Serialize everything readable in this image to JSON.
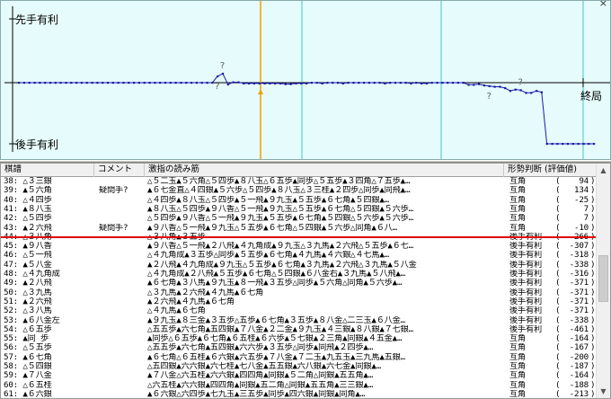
{
  "graph": {
    "top_label": "先手有利",
    "bottom_label": "後手有利",
    "end_label": "終局",
    "close_glyph": "×",
    "question_mark": "?",
    "line_color": "#1a1aa8",
    "cursor_color": "#f0a000",
    "bg_color": "#e6fbfb",
    "evals": [
      0,
      0,
      0,
      0,
      0,
      0,
      0,
      0,
      0,
      0,
      0,
      0,
      0,
      0,
      0,
      0,
      0,
      0,
      0,
      0,
      0,
      0,
      0,
      0,
      0,
      0,
      0,
      0,
      0,
      0,
      0,
      0,
      0,
      0,
      0,
      0,
      0,
      0,
      94,
      134,
      -25,
      7,
      7,
      -10,
      -10,
      -10,
      -10,
      -10,
      -10,
      -10,
      -10,
      -20,
      -20,
      -10,
      -10,
      -10,
      0,
      0,
      -10,
      0,
      0,
      0,
      -10,
      0,
      0,
      0,
      0,
      0,
      0,
      0,
      -10,
      0,
      0,
      0,
      0,
      -10,
      0,
      -10,
      -10,
      0,
      0,
      0,
      0,
      0,
      0,
      0,
      -30,
      -30,
      -20,
      -40,
      -50,
      -60,
      -60,
      -80,
      -120,
      -100,
      -110,
      -150,
      -150,
      -120,
      -140,
      -900,
      -900,
      -900,
      -900,
      -900,
      -900,
      -900,
      -900,
      -900,
      -900
    ],
    "question_moves": [
      38,
      39,
      90,
      96
    ],
    "cursor_move": 39
  },
  "list": {
    "headers": {
      "move": "棋譜",
      "comment": "コメント",
      "pv": "激指の読み筋",
      "judge": "形勢判断 (評価値)"
    },
    "rows": [
      {
        "move": "38: △３三銀",
        "comment": "",
        "pv": "△５二玉▲５六角△５四歩▲８八玉△６五歩▲同歩△５五歩▲３四角△７五歩▲…",
        "judge": "互角",
        "score": "94"
      },
      {
        "move": "39: ▲５六角",
        "comment": "疑問手?",
        "pv": "▲６七金直△４四銀▲５六歩△５四歩▲８八玉△３三桂▲２四歩△同歩▲同飛▲…",
        "judge": "互角",
        "score": "134"
      },
      {
        "move": "40: △４四歩",
        "comment": "",
        "pv": "△４四歩▲８八玉△５四歩▲５一飛▲９九玉▲５五歩▲６七角▲５四銀▲…",
        "judge": "互角",
        "score": "-25"
      },
      {
        "move": "41: ▲８八玉",
        "comment": "",
        "pv": "▲８八玉△５四歩▲９八香△５一飛▲９九玉△５五歩▲６七角△５四銀▲５六歩…",
        "judge": "互角",
        "score": "7"
      },
      {
        "move": "42: △５四歩",
        "comment": "",
        "pv": "△５四歩▲９八香△５一飛▲９九玉▲５五歩▲６七角▲５四銀△５六歩▲５六歩…",
        "judge": "互角",
        "score": "7"
      },
      {
        "move": "43: ▲２六飛",
        "comment": "疑問手?",
        "pv": "▲９八香△５一飛▲９九玉△５五歩▲６七角△５四銀▲５六歩△同角▲６八…",
        "judge": "互角",
        "score": "-10"
      },
      {
        "move": "44: △３八角",
        "comment": "",
        "pv": "△３八角▲３五歩",
        "judge": "後手有利",
        "score": "-266"
      },
      {
        "move": "45: ▲９八香",
        "comment": "",
        "pv": "▲９八香△５一飛▲２八飛▲４九角成▲９九玉△３九馬▲２六飛△５五歩▲６七…",
        "judge": "後手有利",
        "score": "-307"
      },
      {
        "move": "46: △５一飛",
        "comment": "",
        "pv": "△４九角成▲３五歩△同歩▲５五歩▲６七角▲４九馬▲４六銀△４七馬▲…",
        "judge": "後手有利",
        "score": "-318"
      },
      {
        "move": "47: ▲５八金",
        "comment": "",
        "pv": "▲２八飛▲４九角成▲９九玉△５五歩▲６七角▲３九馬▲２六飛△３九馬▲５八金",
        "judge": "後手有利",
        "score": "-338"
      },
      {
        "move": "48: △４九角成",
        "comment": "",
        "pv": "△４九角成▲２八飛▲５五歩▲６七角△５四銀▲６八金右▲３九馬▲５八飛▲…",
        "judge": "後手有利",
        "score": "-316"
      },
      {
        "move": "49: ▲２八飛",
        "comment": "",
        "pv": "▲６七角▲３八馬▲９九玉▲８一飛▲３五歩△同歩▲５六角△同角▲５六歩▲…",
        "judge": "後手有利",
        "score": "-371"
      },
      {
        "move": "50: △３九馬",
        "comment": "",
        "pv": "△３九馬▲２六飛▲４九馬▲６七角",
        "judge": "後手有利",
        "score": "-371"
      },
      {
        "move": "51: ▲２六飛",
        "comment": "",
        "pv": "▲２六飛▲４九馬▲６七角",
        "judge": "後手有利",
        "score": "-371"
      },
      {
        "move": "52: △３八馬",
        "comment": "",
        "pv": "△４九馬▲６七角",
        "judge": "後手有利",
        "score": "-371"
      },
      {
        "move": "53: ▲６八金左",
        "comment": "",
        "pv": "▲９九玉▲８三金▲３五歩△五歩▲６七角▲３五歩▲８八金△二三玉▲６八金…",
        "judge": "後手有利",
        "score": "-338"
      },
      {
        "move": "54: △６五歩",
        "comment": "",
        "pv": "△五五歩▲六七角▲五四銀▲７八金▲２二金▲９九玉▲４三銀▲８八銀▲７七銀…",
        "judge": "後手有利",
        "score": "-461"
      },
      {
        "move": "55: ▲同 歩",
        "comment": "",
        "pv": "▲同歩△６五歩▲６七角▲６五桂▲６六歩▲５七銀▲２三角▲同銀▲４五金▲…",
        "judge": "互角",
        "score": "-164"
      },
      {
        "move": "56: △５五歩",
        "comment": "",
        "pv": "△五五歩▲六七角▲五四銀▲六六歩▲３五歩△同歩▲同飛▲２四歩▲…",
        "judge": "互角",
        "score": "-167"
      },
      {
        "move": "57: ▲６七角",
        "comment": "",
        "pv": "▲６七角△６五桂▲６六銀▲六五歩▲７八金▲７二玉▲九五玉▲三九馬▲五銀…",
        "judge": "互角",
        "score": "-200"
      },
      {
        "move": "58: △５四銀",
        "comment": "",
        "pv": "△五四銀▲六六銀▲六七桂▲七八金▲五五銀▲六八銀▲六七金▲同銀▲…",
        "judge": "互角",
        "score": "-187"
      },
      {
        "move": "59: ▲７八金",
        "comment": "",
        "pv": "▲７八金△六五桂▲六六銀▲四四角▲同銀▲５二角△同銀▲五五角▲…",
        "judge": "互角",
        "score": "-164"
      },
      {
        "move": "60: △６五桂",
        "comment": "",
        "pv": "△六五桂▲六六銀▲四四角▲同銀▲五二角△同銀▲五五角▲三三銀▲…",
        "judge": "互角",
        "score": "-188"
      },
      {
        "move": "61: ▲６六銀",
        "comment": "",
        "pv": "▲６六銀△六四歩▲七九玉▲三五歩▲同歩▲四六銀▲同銀▲同角▲…",
        "judge": "互角",
        "score": "-213"
      }
    ]
  }
}
